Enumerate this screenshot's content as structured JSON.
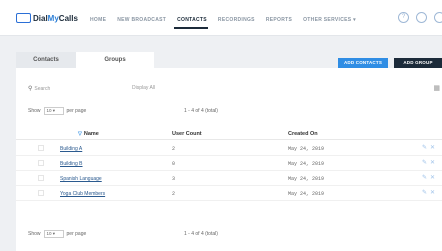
{
  "brand": {
    "part1": "Dial",
    "part2": "My",
    "part3": "Calls"
  },
  "nav": [
    {
      "label": "HOME"
    },
    {
      "label": "NEW BROADCAST"
    },
    {
      "label": "CONTACTS"
    },
    {
      "label": "RECORDINGS"
    },
    {
      "label": "REPORTS"
    },
    {
      "label": "OTHER SERVICES ▾"
    }
  ],
  "header_icons": {
    "help": "?",
    "chat": "◯"
  },
  "tabs": {
    "contacts": "Contacts",
    "groups": "Groups"
  },
  "buttons": {
    "add_contacts": "ADD CONTACTS",
    "add_group": "ADD GROUP"
  },
  "search": {
    "icon": "⚲",
    "placeholder": "Search",
    "display": "Display All"
  },
  "pager_top": {
    "show": "Show",
    "per_page_value": "10 ▾",
    "per_page": "per page",
    "range": "1 - 4 of 4 (total)"
  },
  "pager_bottom": {
    "show": "Show",
    "per_page_value": "10 ▾",
    "per_page": "per page",
    "range": "1 - 4 of 4 (total)"
  },
  "table": {
    "columns": {
      "name": "Name",
      "count": "User Count",
      "created": "Created On"
    },
    "rows": [
      {
        "name": "Building A",
        "count": "2",
        "created": "May 24, 2019"
      },
      {
        "name": "Building B",
        "count": "0",
        "created": "May 24, 2019"
      },
      {
        "name": "Spanish Language",
        "count": "3",
        "created": "May 24, 2019"
      },
      {
        "name": "Yoga Club Members",
        "count": "2",
        "created": "May 24, 2019"
      }
    ]
  },
  "colors": {
    "accent": "#2f8de4",
    "dark": "#1c2b3a",
    "link": "#2b5a8f"
  }
}
